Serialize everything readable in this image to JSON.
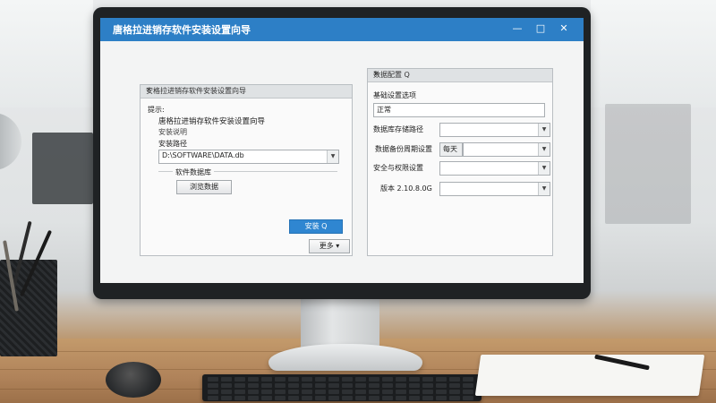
{
  "app": {
    "title": "唐格拉进销存软件安装设置向导",
    "window_controls": {
      "minimize": "—",
      "maximize": "□",
      "close": "✕"
    }
  },
  "left_dialog": {
    "title": "安格拉进销存软件安装设置向导",
    "close": "✕",
    "section_label": "提示:",
    "heading": "唐格拉进销存软件安装设置向导",
    "sub_label": "安装说明",
    "path_label": "安装路径",
    "path_value": "D:\\SOFTWARE\\DATA.db",
    "group_label": "软件数据库",
    "browse_button": "浏览数据",
    "next_button": "安装 Q",
    "extra_button": "更多 ▾"
  },
  "right_dialog": {
    "title": "数据配置 Q",
    "close": "✕",
    "row1_label": "基础设置选项",
    "row1_value": "正常",
    "row2_label": "数据库存储路径",
    "row3_label": "数据备份周期设置",
    "row3_chip": "每天",
    "row4_label": "安全与权限设置",
    "row5_label": "版本 2.10.8.0G"
  },
  "colors": {
    "titlebar": "#2d7fc6",
    "primary_button": "#2f86d1"
  },
  "icons": {
    "dropdown": "chevron-down-icon",
    "close": "close-icon"
  }
}
